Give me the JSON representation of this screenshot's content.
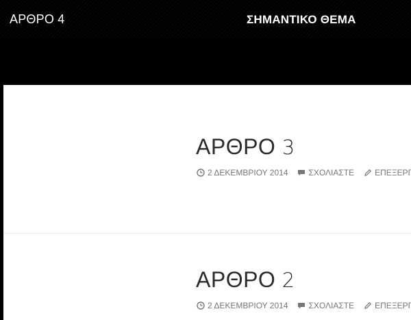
{
  "header": {
    "left_title_word": "ΑΡΘΡΟ",
    "left_title_num": "4",
    "right_title": "ΣΗΜΑΝΤΙΚΟ ΘΕΜΑ"
  },
  "posts": [
    {
      "title_word": "ΑΡΘΡΟ",
      "title_num": "3",
      "date": "2 ΔΕΚΕΜΒΡΙΟΥ 2014",
      "comments_label": "ΣΧΟΛΙΑΣΤΕ",
      "edit_label": "ΕΠΕΞΕΡΓ"
    },
    {
      "title_word": "ΑΡΘΡΟ",
      "title_num": "2",
      "date": "2 ΔΕΚΕΜΒΡΙΟΥ 2014",
      "comments_label": "ΣΧΟΛΙΑΣΤΕ",
      "edit_label": "ΕΠΕΞΕΡΓ"
    }
  ],
  "icons": {
    "date": "clock-icon",
    "comments": "speech-bubble-icon",
    "edit": "pencil-icon"
  },
  "colors": {
    "header_bg": "#000000",
    "content_bg": "#ffffff",
    "title_text": "#2b2b2b",
    "meta_text": "#767676"
  }
}
